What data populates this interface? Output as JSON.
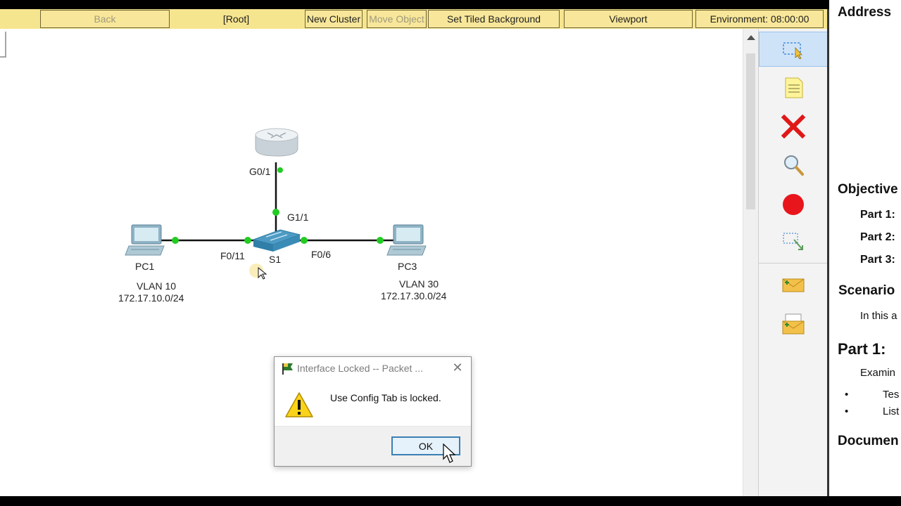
{
  "toolbar": {
    "back_label": "Back",
    "root_label": "[Root]",
    "new_cluster_label": "New Cluster",
    "move_object_label": "Move Object",
    "set_tiled_background_label": "Set Tiled Background",
    "viewport_label": "Viewport",
    "environment_label": "Environment: 08:00:00"
  },
  "topology": {
    "router_port": "G0/1",
    "switch_uplink_port": "G1/1",
    "switch_name": "S1",
    "switch_port_pc1": "F0/11",
    "switch_port_pc3": "F0/6",
    "pc1": {
      "name": "PC1",
      "vlan": "VLAN 10",
      "subnet": "172.17.10.0/24"
    },
    "pc3": {
      "name": "PC3",
      "vlan": "VLAN 30",
      "subnet": "172.17.30.0/24"
    }
  },
  "tools": [
    "select-tool",
    "note-tool",
    "delete-tool",
    "inspect-tool",
    "draw-ellipse-tool",
    "resize-shape-tool",
    "add-simple-pdu-tool",
    "add-complex-pdu-tool"
  ],
  "instructions": {
    "addressing": "Address",
    "objectives": "Objective",
    "part1": "Part 1:",
    "part2": "Part 2:",
    "part3": "Part 3:",
    "scenario": "Scenario",
    "scenario_text": "In this a",
    "part1_heading": "Part 1:",
    "part1_text": "Examin",
    "bullet1": "Tes",
    "bullet2": "List",
    "documentation": "Documen"
  },
  "dialog": {
    "title": "Interface Locked -- Packet ...",
    "message": "Use Config Tab is locked.",
    "ok_label": "OK"
  },
  "colors": {
    "toolbar": "#f6e58f",
    "link_up": "#22cc22",
    "delete_red": "#e01818",
    "ok_border": "#3c7fb1"
  }
}
